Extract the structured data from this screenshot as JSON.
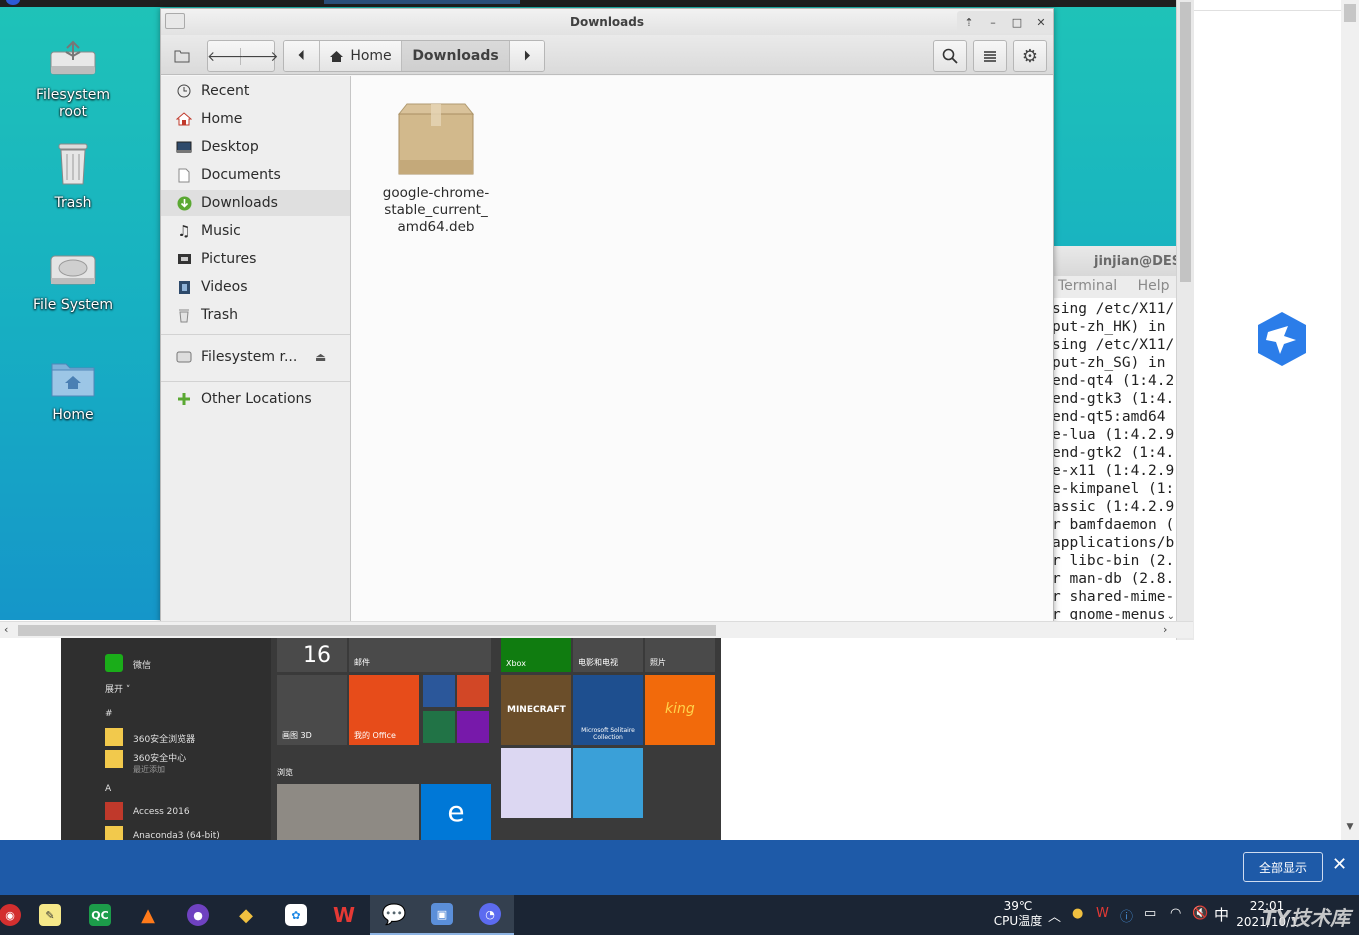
{
  "desktop": {
    "icons": [
      {
        "label": "Filesystem root"
      },
      {
        "label": "Trash"
      },
      {
        "label": "File System"
      },
      {
        "label": "Home"
      }
    ]
  },
  "terminal": {
    "title": "jinjian@DES",
    "menu": [
      "Terminal",
      "Help"
    ],
    "lines": [
      "sing /etc/X11/",
      "put-zh_HK) in",
      "sing /etc/X11/",
      "put-zh_SG) in",
      "end-qt4 (1:4.2",
      "end-gtk3 (1:4.",
      "end-qt5:amd64",
      "e-lua (1:4.2.9",
      "end-gtk2 (1:4.",
      "e-x11 (1:4.2.9",
      "e-kimpanel (1:",
      "assic (1:4.2.9",
      "r bamfdaemon (",
      "applications/b",
      "r libc-bin (2.",
      "r man-db (2.8.",
      "r shared-mime-",
      "r gnome-menus"
    ]
  },
  "file_manager": {
    "title": "Downloads",
    "breadcrumbs": [
      {
        "label": "Home"
      },
      {
        "label": "Downloads"
      }
    ],
    "sidebar": {
      "items": [
        {
          "label": "Recent",
          "icon": "clock-icon"
        },
        {
          "label": "Home",
          "icon": "home-icon"
        },
        {
          "label": "Desktop",
          "icon": "desktop-icon"
        },
        {
          "label": "Documents",
          "icon": "document-icon"
        },
        {
          "label": "Downloads",
          "icon": "download-icon"
        },
        {
          "label": "Music",
          "icon": "music-icon"
        },
        {
          "label": "Pictures",
          "icon": "pictures-icon"
        },
        {
          "label": "Videos",
          "icon": "videos-icon"
        },
        {
          "label": "Trash",
          "icon": "trash-icon"
        }
      ],
      "devices": [
        {
          "label": "Filesystem r..."
        }
      ],
      "other": [
        {
          "label": "Other Locations"
        }
      ]
    },
    "files": [
      {
        "name_lines": [
          "google-chrome-",
          "stable_current_",
          "amd64.deb"
        ],
        "icon": "package-icon"
      }
    ]
  },
  "start_menu": {
    "list": [
      {
        "label": "微信"
      },
      {
        "label": "展开 ˅"
      },
      {
        "label": "#"
      },
      {
        "label": "360安全浏览器"
      },
      {
        "label": "360安全中心"
      },
      {
        "label": "最近添加"
      },
      {
        "label": "A"
      },
      {
        "label": "Access 2016"
      },
      {
        "label": "Anaconda3 (64-bit)"
      }
    ],
    "tiles": [
      {
        "label": "16"
      },
      {
        "label": "邮件"
      },
      {
        "label": "Xbox"
      },
      {
        "label": "电影和电视"
      },
      {
        "label": "照片"
      },
      {
        "label": "画图 3D"
      },
      {
        "label": "我的 Office"
      },
      {
        "label": "MINECRAFT"
      },
      {
        "label": "Microsoft Solitaire Collection"
      },
      {
        "label": "king"
      },
      {
        "label": "浏览"
      }
    ]
  },
  "notification": {
    "show_all": "全部显示",
    "close": "✕"
  },
  "taskbar": {
    "apps": [
      {
        "icon": "netease-icon"
      },
      {
        "icon": "notepad-icon"
      },
      {
        "icon": "qc-icon",
        "text": "QC"
      },
      {
        "icon": "matlab-icon"
      },
      {
        "icon": "github-icon"
      },
      {
        "icon": "git-icon"
      },
      {
        "icon": "pinwheel-icon"
      },
      {
        "icon": "wps-icon",
        "text": "W"
      },
      {
        "icon": "wechat-icon"
      },
      {
        "icon": "remote-desktop-icon"
      },
      {
        "icon": "chrome-like-icon"
      }
    ],
    "tray": {
      "temp": "39℃",
      "temp_label": "CPU温度",
      "ime": "中",
      "time": "22:01",
      "date": "2021/10/1"
    }
  },
  "watermark": "TY技术库"
}
